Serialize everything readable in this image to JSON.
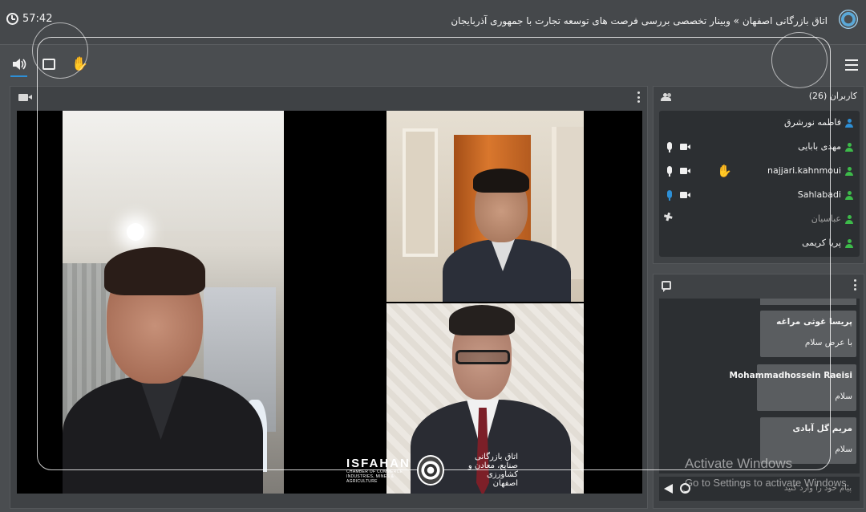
{
  "header": {
    "timer": "57:42",
    "title": "اتاق بازرگانی اصفهان » وبینار تخصصی بررسی فرصت های توسعه تجارت با جمهوری آذربایجان"
  },
  "controls": {
    "icons": [
      "speaker-icon",
      "screen-share-icon",
      "raise-hand-icon",
      "hamburger-menu-icon"
    ]
  },
  "branding": {
    "en_title": "ISFAHAN",
    "en_sub1": "CHAMBER OF COMMERCE",
    "en_sub2": "INDUSTRIES, MINES & AGRICULTURE",
    "fa_line1": "اتاق بازرگانی",
    "fa_line2": "صنایع، معادن و کشاورزی",
    "fa_line3": "اصفهان"
  },
  "users": {
    "title": "کاربران (26)",
    "list": [
      {
        "name": "فاطمه نورشرق",
        "color": "#2d8fd6",
        "mic": false,
        "cam": false,
        "dim": false
      },
      {
        "name": "مهدی بابایی",
        "color": "#3dbb4a",
        "mic": true,
        "cam": true,
        "dim": false
      },
      {
        "name": "najjari.kahnmoui",
        "color": "#3dbb4a",
        "mic": true,
        "cam": true,
        "dim": false,
        "hand": true
      },
      {
        "name": "Sahlabadi",
        "color": "#3dbb4a",
        "mic": true,
        "mic_active": true,
        "cam": true,
        "dim": false
      },
      {
        "name": "عباسیان",
        "color": "#3dbb4a",
        "mic": false,
        "cam": false,
        "dim": true,
        "banned": true
      },
      {
        "name": "پریا کریمی",
        "color": "#3dbb4a",
        "mic": false,
        "cam": false,
        "dim": false
      }
    ]
  },
  "chat": {
    "messages": [
      {
        "author": "پریسا غوثی مراغه",
        "text": "با عرض سلام"
      },
      {
        "author": "Mohammadhossein Raeisi",
        "text": "سلام"
      },
      {
        "author": "مریم گل آبادی",
        "text": "سلام"
      }
    ],
    "placeholder": "پیام خود را وارد کنید"
  },
  "watermark": {
    "line1": "Activate Windows",
    "line2": "Go to Settings to activate Windows."
  }
}
